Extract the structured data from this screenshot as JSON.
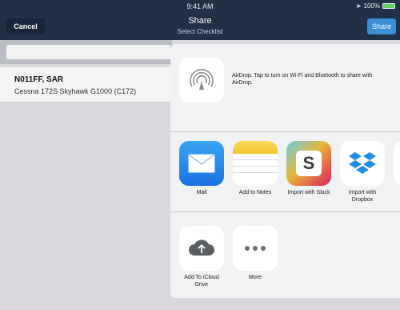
{
  "status": {
    "time": "9:41 AM",
    "battery": "100%"
  },
  "nav": {
    "title": "Share",
    "subtitle": "Select Checklist",
    "cancel_label": "Cancel",
    "share_label": "Share"
  },
  "list": {
    "row": {
      "title": "N011FF, SAR",
      "subtitle": "Cessna 172S Skyhawk G1000 (C172)"
    }
  },
  "share_sheet": {
    "airdrop": {
      "description": "AirDrop. Tap to turn on Wi-Fi and Bluetooth to share with AirDrop.",
      "icon": "airdrop-icon"
    },
    "apps": [
      {
        "label": "Mail",
        "icon": "mail-icon"
      },
      {
        "label": "Add to Notes",
        "icon": "notes-icon"
      },
      {
        "label": "Import with Slack",
        "icon": "slack-icon"
      },
      {
        "label": "Import with Dropbox",
        "icon": "dropbox-icon"
      }
    ],
    "actions": [
      {
        "label": "Add To iCloud Drive",
        "icon": "icloud-drive-icon"
      },
      {
        "label": "More",
        "icon": "more-icon"
      }
    ]
  },
  "colors": {
    "nav_bg": "#1f3047",
    "accent": "#3a8fd6"
  }
}
